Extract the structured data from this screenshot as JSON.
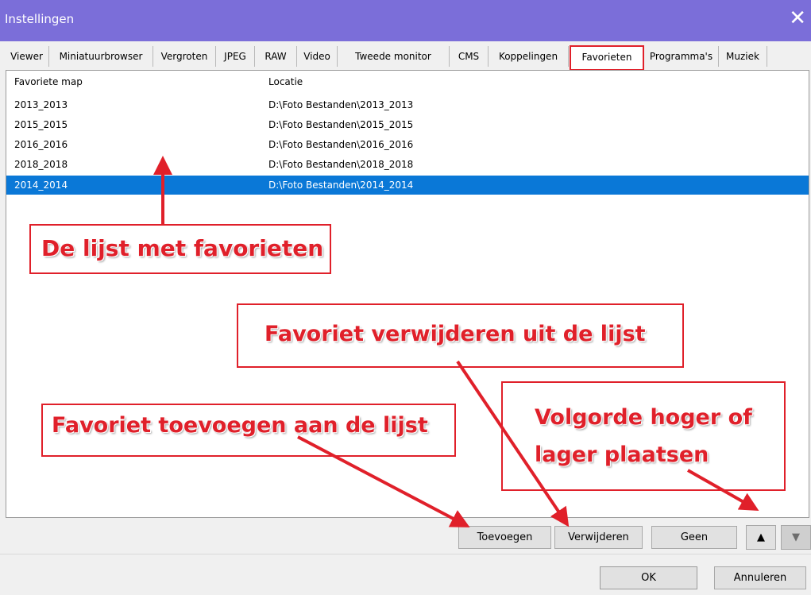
{
  "window": {
    "title": "Instellingen"
  },
  "tabs": [
    "Viewer",
    "Miniatuurbrowser",
    "Vergroten",
    "JPEG",
    "RAW",
    "Video",
    "Tweede monitor",
    "CMS",
    "Koppelingen",
    "Favorieten",
    "Programma's",
    "Muziek"
  ],
  "active_tab": "Favorieten",
  "list": {
    "headers": [
      "Favoriete map",
      "Locatie"
    ],
    "rows": [
      {
        "name": "2013_2013",
        "path": "D:\\Foto Bestanden\\2013_2013",
        "selected": false
      },
      {
        "name": "2015_2015",
        "path": "D:\\Foto Bestanden\\2015_2015",
        "selected": false
      },
      {
        "name": "2016_2016",
        "path": "D:\\Foto Bestanden\\2016_2016",
        "selected": false
      },
      {
        "name": "2018_2018",
        "path": "D:\\Foto Bestanden\\2018_2018",
        "selected": false
      },
      {
        "name": "2014_2014",
        "path": "D:\\Foto Bestanden\\2014_2014",
        "selected": true
      }
    ]
  },
  "annotations": {
    "list": "De  lijst met favorieten",
    "remove": "Favoriet verwijderen uit de lijst",
    "add": "Favoriet toevoegen aan de lijst",
    "order_line1": "Volgorde hoger of",
    "order_line2": "lager plaatsen"
  },
  "buttons": {
    "add": "Toevoegen",
    "remove": "Verwijderen",
    "none": "Geen",
    "up": "▲",
    "down": "▼",
    "ok": "OK",
    "cancel": "Annuleren"
  },
  "colors": {
    "accent_selected": "#0a78d7",
    "titlebar": "#7b6ed9",
    "annotation": "#e0202a"
  }
}
